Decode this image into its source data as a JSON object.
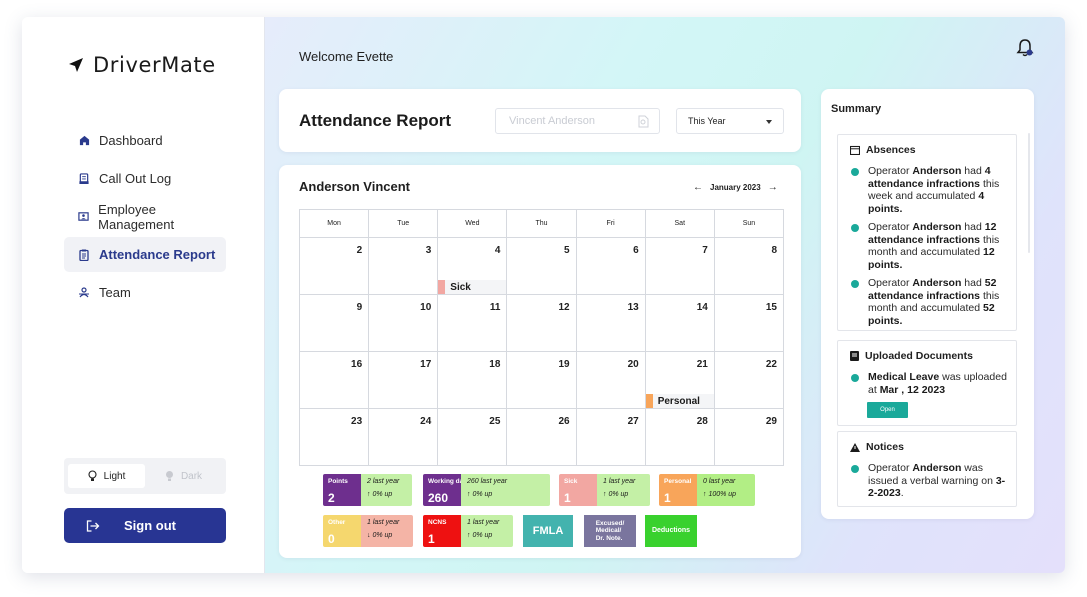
{
  "app": {
    "name": "DriverMate"
  },
  "sidebar": {
    "items": [
      {
        "label": "Dashboard",
        "icon": "home-icon"
      },
      {
        "label": "Call Out Log",
        "icon": "clipboard-icon"
      },
      {
        "label": "Employee Management",
        "icon": "id-card-icon"
      },
      {
        "label": "Attendance Report",
        "icon": "report-icon",
        "active": true
      },
      {
        "label": "Team",
        "icon": "team-icon"
      }
    ],
    "theme": {
      "light": "Light",
      "dark": "Dark",
      "selected": "Light"
    },
    "signout_label": "Sign out"
  },
  "header": {
    "welcome": "Welcome Evette"
  },
  "report": {
    "title": "Attendance Report",
    "search_placeholder": "Vincent Anderson",
    "period": "This Year"
  },
  "calendar": {
    "employee": "Anderson Vincent",
    "month": "January 2023",
    "weekdays": [
      "Mon",
      "Tue",
      "Wed",
      "Thu",
      "Fri",
      "Sat",
      "Sun"
    ],
    "weeks": [
      [
        {
          "d": "2"
        },
        {
          "d": "3"
        },
        {
          "d": "4",
          "event": "Sick"
        },
        {
          "d": "5"
        },
        {
          "d": "6"
        },
        {
          "d": "7"
        },
        {
          "d": "8"
        }
      ],
      [
        {
          "d": "9"
        },
        {
          "d": "10"
        },
        {
          "d": "11"
        },
        {
          "d": "12"
        },
        {
          "d": "13"
        },
        {
          "d": "14"
        },
        {
          "d": "15"
        }
      ],
      [
        {
          "d": "16"
        },
        {
          "d": "17"
        },
        {
          "d": "18"
        },
        {
          "d": "19"
        },
        {
          "d": "20"
        },
        {
          "d": "21",
          "event": "Personal"
        },
        {
          "d": "22"
        }
      ],
      [
        {
          "d": "23"
        },
        {
          "d": "24"
        },
        {
          "d": "25"
        },
        {
          "d": "26"
        },
        {
          "d": "27"
        },
        {
          "d": "28"
        },
        {
          "d": "29"
        }
      ]
    ],
    "event_colors": {
      "Sick": "#f2a7a2",
      "Personal": "#f8a55a"
    }
  },
  "legend": {
    "stats": [
      {
        "label": "Points",
        "value": "2",
        "last": "2 last year",
        "change": "↑ 0% up",
        "color": "#6e2f8e",
        "bg": "#c4f0a6"
      },
      {
        "label": "Working days",
        "value": "260",
        "last": "260 last year",
        "change": "↑ 0% up",
        "color": "#6e2f8e",
        "bg": "#c4f0a6"
      },
      {
        "label": "Sick",
        "value": "1",
        "last": "1 last year",
        "change": "↑ 0% up",
        "color": "#f2a7a2",
        "bg": "#c4f0a6"
      },
      {
        "label": "Personal",
        "value": "1",
        "last": "0 last year",
        "change": "↑ 100% up",
        "color": "#f8a55a",
        "bg": "#b2ee85"
      },
      {
        "label": "Other",
        "value": "0",
        "last": "1 last year",
        "change": "↓ 0% up",
        "color": "#f5d76e",
        "bg": "#f4b4a6"
      },
      {
        "label": "NCNS",
        "value": "1",
        "last": "1 last year",
        "change": "↑ 0% up",
        "color": "#ee1111",
        "bg": "#c4f0a6"
      }
    ],
    "fmla": {
      "label": "FMLA",
      "color": "#43b3ae"
    },
    "excused": {
      "label": "Excused/\nMedical/\nDr. Note.",
      "color": "#7a759e"
    },
    "deductions": {
      "label": "Deductions",
      "color": "#39d12e"
    }
  },
  "summary": {
    "title": "Summary",
    "absences": {
      "title": "Absences",
      "items": [
        {
          "pre": "Operator ",
          "name": "Anderson",
          "mid1": " had ",
          "count": "4",
          "mid2": " attendance infractions",
          "mid3": " this week and accumulated ",
          "pts": "4",
          "tail": " points."
        },
        {
          "pre": "Operator ",
          "name": "Anderson",
          "mid1": " had ",
          "count": "12",
          "mid2": " attendance infractions",
          "mid3": " this month and accumulated ",
          "pts": "12",
          "tail": " points."
        },
        {
          "pre": "Operator ",
          "name": "Anderson",
          "mid1": " had ",
          "count": "52",
          "mid2": " attendance infractions",
          "mid3": " this month and accumulated ",
          "pts": "52",
          "tail": " points."
        }
      ]
    },
    "documents": {
      "title": "Uploaded Documents",
      "doc_name": "Medical Leave",
      "doc_mid": " was uploaded at ",
      "doc_date": "Mar , 12 2023",
      "open_label": "Open"
    },
    "notices": {
      "title": "Notices",
      "pre": "Operator ",
      "name": "Anderson",
      "mid": " was issued a verbal warning on ",
      "date": "3-2-2023",
      "tail": "."
    }
  },
  "colors": {
    "accent": "#283593",
    "teal": "#1aa99a"
  }
}
